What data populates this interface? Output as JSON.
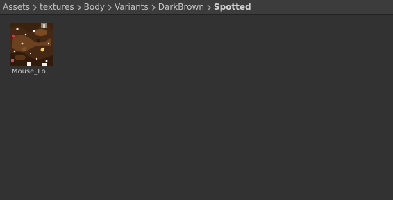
{
  "breadcrumb": {
    "items": [
      "Assets",
      "textures",
      "Body",
      "Variants",
      "DarkBrown"
    ],
    "current": "Spotted"
  },
  "assets": [
    {
      "name": "Mouse_Lo...",
      "icon": "texture-thumbnail"
    }
  ],
  "colors": {
    "background": "#323232",
    "header": "#3c3c3c",
    "text": "#c4c4c4"
  }
}
